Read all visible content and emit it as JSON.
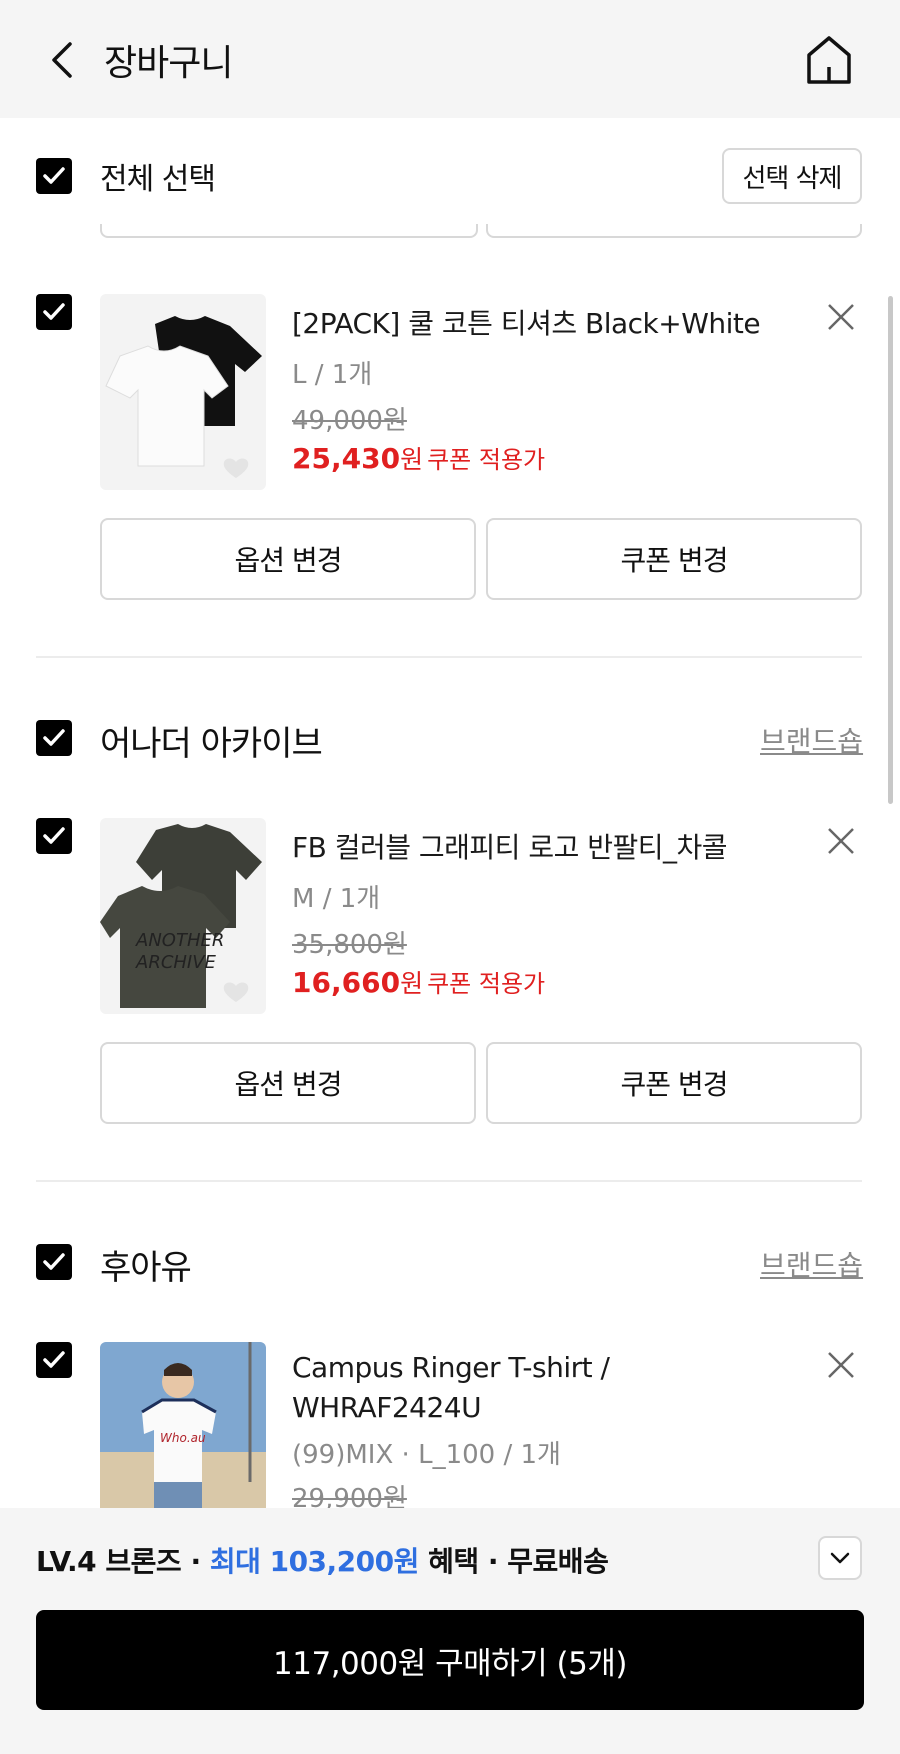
{
  "header": {
    "title": "장바구니"
  },
  "toolbar": {
    "select_all_label": "전체 선택",
    "delete_selected_label": "선택 삭제"
  },
  "items": [
    {
      "name": "[2PACK] 쿨 코튼 티셔츠 Black+White",
      "option": "L / 1개",
      "original_price": "49,000원",
      "sale_price": "25,430",
      "unit": "원",
      "coupon_note": "쿠폰 적용가",
      "option_button": "옵션 변경",
      "coupon_button": "쿠폰 변경"
    },
    {
      "name": "FB 컬러블 그래피티 로고 반팔티_차콜",
      "option": "M / 1개",
      "original_price": "35,800원",
      "sale_price": "16,660",
      "unit": "원",
      "coupon_note": "쿠폰 적용가",
      "option_button": "옵션 변경",
      "coupon_button": "쿠폰 변경"
    },
    {
      "name_line1": "Campus Ringer T-shirt /",
      "name_line2": "WHRAF2424U",
      "option": "(99)MIX · L_100 / 1개",
      "original_price": "29,900원"
    }
  ],
  "brands": [
    {
      "name": "어나더 아카이브",
      "shop_link": "브랜드숍"
    },
    {
      "name": "후아유",
      "shop_link": "브랜드숍"
    }
  ],
  "bottom": {
    "benefit_prefix": "LV.4 브론즈 · ",
    "benefit_highlight": "최대 103,200원",
    "benefit_suffix": " 혜택 · 무료배송",
    "buy_button": "117,000원 구매하기 (5개)"
  },
  "colors": {
    "sale_red": "#e02020",
    "highlight_blue": "#2f6fe0",
    "checkbox": "#000000"
  }
}
